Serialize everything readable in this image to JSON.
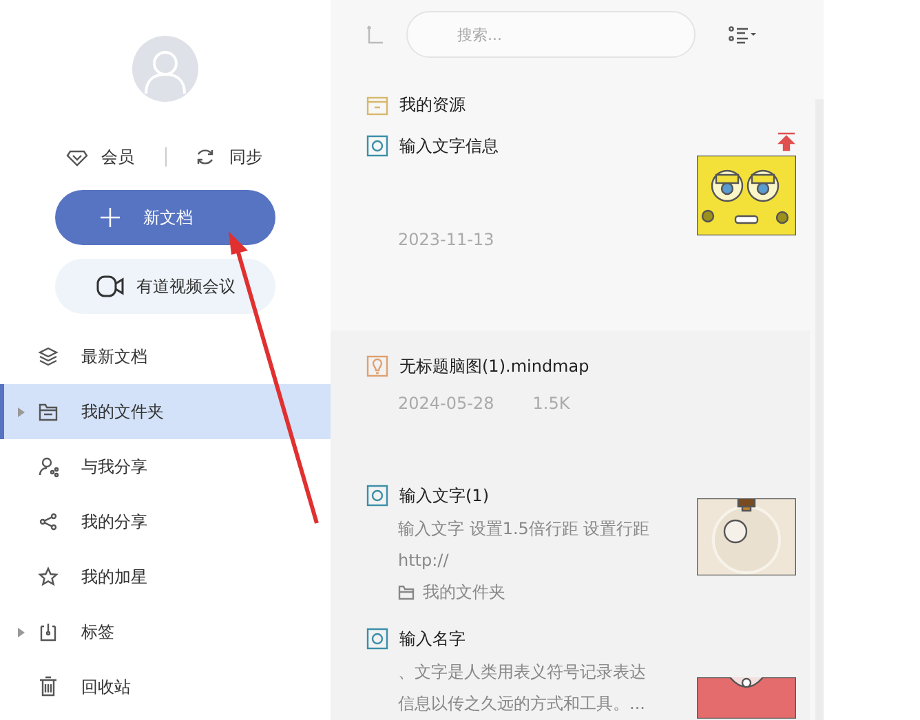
{
  "sidebar": {
    "account": [
      {
        "kind": "member",
        "label": "会员"
      },
      {
        "kind": "sync",
        "label": "同步"
      }
    ],
    "new_button": "新文档",
    "meeting_button": "有道视频会议",
    "items": [
      {
        "kind": "recent",
        "label": "最新文档",
        "selected": false
      },
      {
        "kind": "folder",
        "label": "我的文件夹",
        "selected": true,
        "expanded": false
      },
      {
        "kind": "shared-with-me",
        "label": "与我分享",
        "selected": false
      },
      {
        "kind": "my-share",
        "label": "我的分享",
        "selected": false
      },
      {
        "kind": "star",
        "label": "我的加星",
        "selected": false
      },
      {
        "kind": "tag",
        "label": "标签",
        "selected": false,
        "expanded": false
      },
      {
        "kind": "trash",
        "label": "回收站",
        "selected": false
      }
    ]
  },
  "search": {
    "placeholder": "搜索..."
  },
  "list": {
    "items": [
      {
        "kind": "folder",
        "title": "我的资源"
      },
      {
        "kind": "note",
        "title": "输入文字信息",
        "pinned": true,
        "thumbnail": {
          "kind": "picture"
        },
        "meta": [
          "2023-11-13"
        ]
      },
      {
        "kind": "mindmap",
        "title": "无标题脑图(1).mindmap",
        "pinned": false,
        "meta": [
          "2024-05-28",
          "1.5K"
        ]
      },
      {
        "kind": "note",
        "title": "输入文字(1)",
        "pinned": false,
        "thumbnail": {
          "kind": "picture"
        },
        "snippet": [
          "输入文字 设置1.5倍行距 设置行距",
          "http://"
        ],
        "folder": "我的文件夹"
      },
      {
        "kind": "note",
        "title": "输入名字",
        "pinned": false,
        "thumbnail": {
          "kind": "picture"
        },
        "snippet": [
          "、文字是人类用表义符号记录表达",
          "信息以传之久远的方式和工具。..."
        ]
      }
    ]
  }
}
